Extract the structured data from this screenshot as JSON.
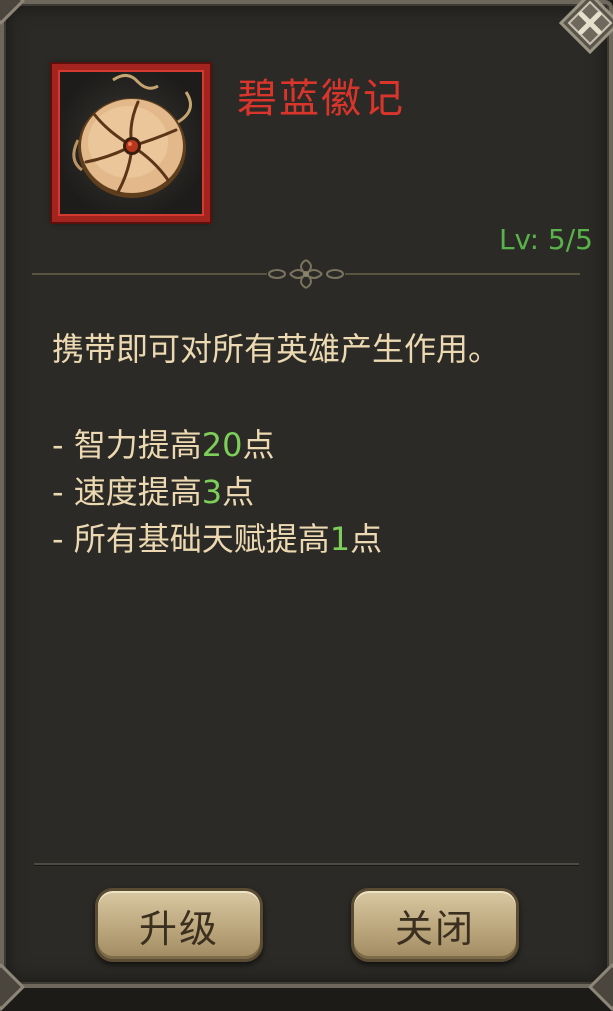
{
  "item": {
    "name": "碧蓝徽记",
    "level": "Lv: 5/5",
    "icon": "medallion-amulet-icon"
  },
  "description": "携带即可对所有英雄产生作用。",
  "effects": [
    {
      "prefix": "- 智力提高",
      "value": "20",
      "suffix": "点"
    },
    {
      "prefix": "- 速度提高",
      "value": "3",
      "suffix": "点"
    },
    {
      "prefix": "- 所有基础天赋提高",
      "value": "1",
      "suffix": "点"
    }
  ],
  "buttons": {
    "upgrade_label": "升级",
    "close_label": "关闭"
  },
  "colors": {
    "item_name": "#d9352c",
    "level": "#58b44a",
    "effect_value": "#7dcf5a",
    "body_text": "#ecd9b1",
    "frame": "#a3231e"
  }
}
